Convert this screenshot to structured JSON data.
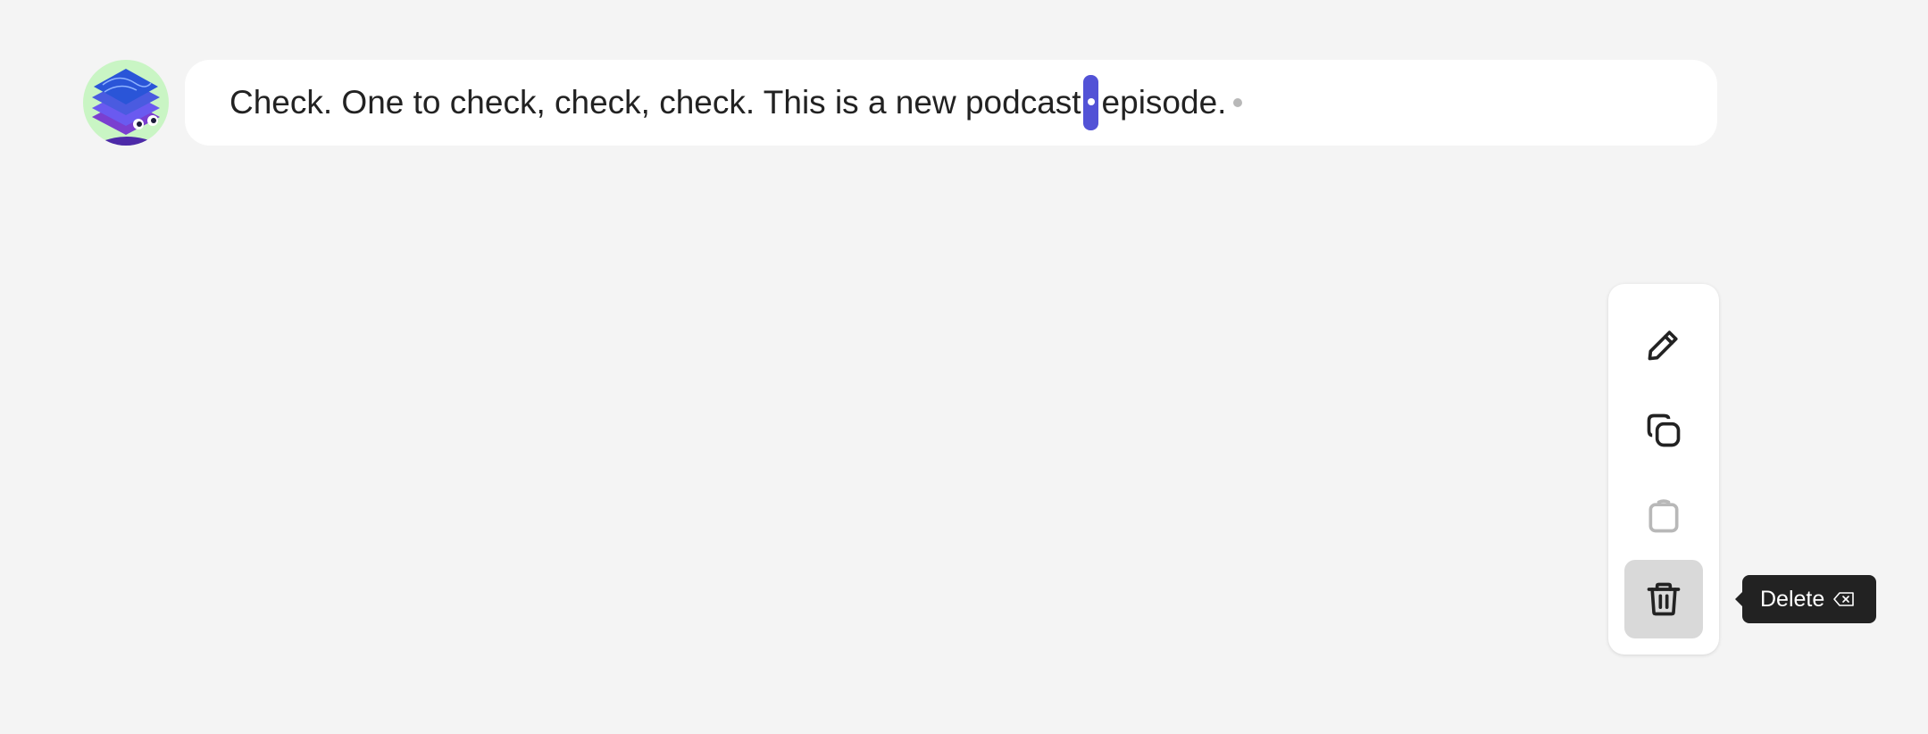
{
  "transcript": {
    "text_before": "Check. One to check, check, check. This is a new podcast",
    "text_after": "episode."
  },
  "toolbar": {
    "buttons": [
      {
        "name": "edit",
        "icon": "pencil-icon"
      },
      {
        "name": "duplicate",
        "icon": "copy-icon"
      },
      {
        "name": "paste",
        "icon": "clipboard-icon",
        "disabled": true
      },
      {
        "name": "delete",
        "icon": "trash-icon",
        "active": true
      }
    ]
  },
  "tooltip": {
    "label": "Delete",
    "shortcut_icon": "backspace-key-icon"
  },
  "colors": {
    "background": "#f4f4f4",
    "selection": "#5252d6",
    "avatar_bg": "#c9f5c4",
    "tooltip_bg": "#222222"
  }
}
